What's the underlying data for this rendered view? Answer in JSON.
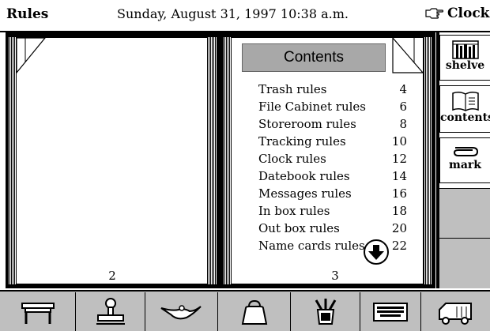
{
  "topbar": {
    "app_title": "Rules",
    "datetime": "Sunday, August 31, 1997  10:38 a.m.",
    "clock_label": "Clock",
    "clock_icon": "pointing-hand-icon"
  },
  "book": {
    "left_page_number": "2",
    "right_page_number": "3",
    "contents_title": "Contents",
    "toc": [
      {
        "title": "Trash rules",
        "page": "4"
      },
      {
        "title": "File Cabinet rules",
        "page": "6"
      },
      {
        "title": "Storeroom rules",
        "page": "8"
      },
      {
        "title": "Tracking rules",
        "page": "10"
      },
      {
        "title": "Clock rules",
        "page": "12"
      },
      {
        "title": "Datebook rules",
        "page": "14"
      },
      {
        "title": "Messages rules",
        "page": "16"
      },
      {
        "title": "In box rules",
        "page": "18"
      },
      {
        "title": "Out box rules",
        "page": "20"
      },
      {
        "title": "Name cards rules",
        "page": "22"
      }
    ],
    "scroll_icon": "scroll-down-arrow-icon"
  },
  "side_tabs": {
    "shelve_label": "shelve",
    "contents_label": "contents",
    "mark_label": "mark"
  },
  "tray": {
    "items": [
      "desk-icon",
      "stamp-icon",
      "genie-lamp-icon",
      "bag-icon",
      "tools-icon",
      "keyboard-icon",
      "truck-icon"
    ]
  }
}
